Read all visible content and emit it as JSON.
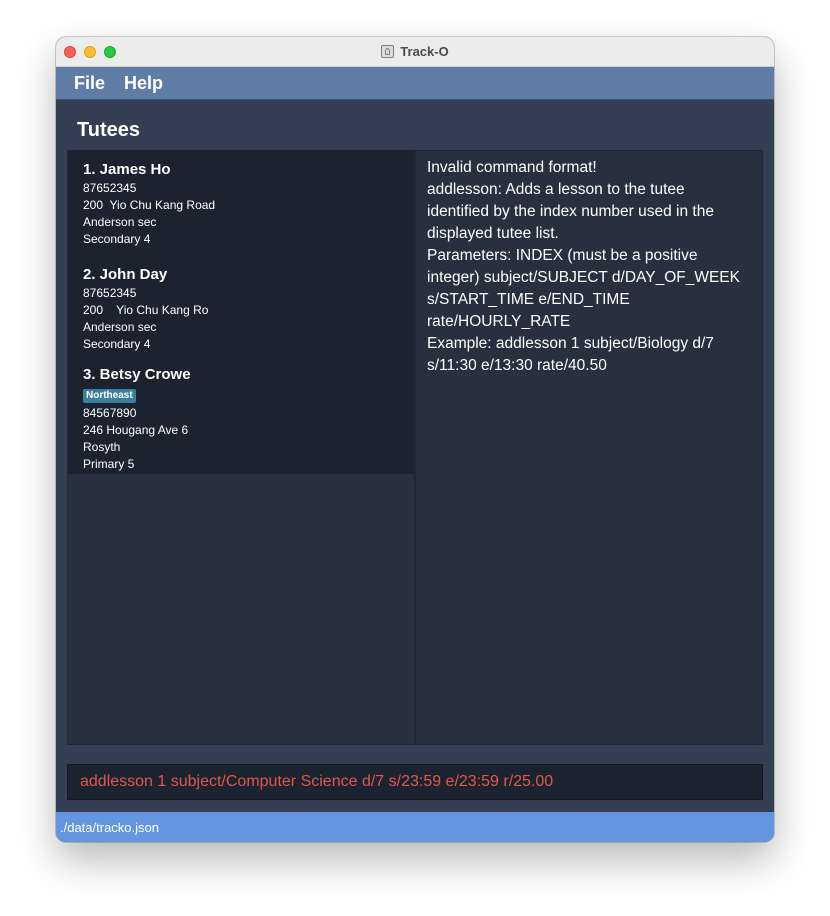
{
  "window": {
    "title": "Track-O"
  },
  "menu": {
    "file": "File",
    "help": "Help"
  },
  "tutees_section": {
    "title": "Tutees"
  },
  "tutees": [
    {
      "heading": "1.  James Ho",
      "tag": "",
      "phone": "87652345",
      "address": "200  Yio Chu Kang Road",
      "school": "Anderson sec",
      "level": "Secondary 4"
    },
    {
      "heading": "2.  John Day",
      "tag": "",
      "phone": "87652345",
      "address": "200    Yio Chu Kang Ro",
      "school": "Anderson sec",
      "level": "Secondary 4"
    },
    {
      "heading": "3.  Betsy Crowe",
      "tag": "Northeast",
      "phone": "84567890",
      "address": "246 Hougang Ave 6",
      "school": "Rosyth",
      "level": "Primary 5"
    }
  ],
  "result_display": {
    "text": "Invalid command format!\naddlesson: Adds a lesson to the tutee\nidentified by the index number used in the\ndisplayed tutee list.\nParameters: INDEX (must be a positive\ninteger) subject/SUBJECT d/DAY_OF_WEEK\ns/START_TIME e/END_TIME\nrate/HOURLY_RATE\nExample: addlesson 1 subject/Biology d/7\ns/11:30 e/13:30 rate/40.50"
  },
  "command_box": {
    "value": "addlesson 1 subject/Computer Science d/7 s/23:59 e/23:59 r/25.00",
    "text_color": "#e05848"
  },
  "status_bar": {
    "path": "./data/tracko.json"
  },
  "colors": {
    "menubar": "#5f7ca6",
    "status_bar": "#6496df",
    "tag": "#3b7f9d"
  }
}
